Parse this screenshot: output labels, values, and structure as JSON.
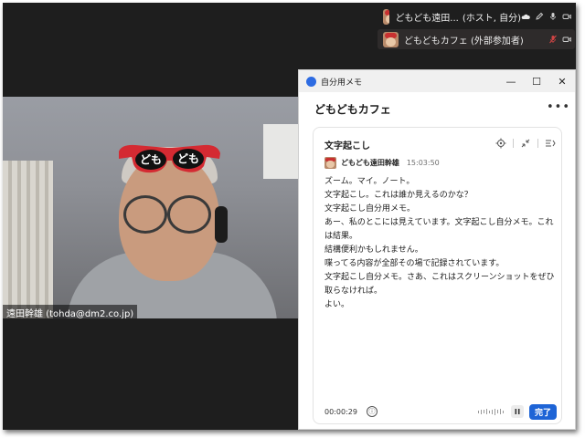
{
  "participants": [
    {
      "name": "どもども遠田...",
      "role": "(ホスト, 自分)"
    },
    {
      "name": "どもどもカフェ (外部参加者)",
      "role": ""
    }
  ],
  "video": {
    "caption": "遠田幹雄 (tohda@dm2.co.jp)",
    "glasses_text": [
      "ども",
      "ども"
    ]
  },
  "memo_window": {
    "title": "自分用メモ",
    "controls": [
      "—",
      "☐",
      "✕"
    ],
    "heading": "どもどもカフェ",
    "more_label": "•••"
  },
  "transcript_card": {
    "title": "文字起こし",
    "speaker_name": "どもども遠田幹雄",
    "speaker_time": "15:03:50",
    "lines": [
      "ズーム。マイ。ノート。",
      "文字起こし。これは誰か見えるのかな？",
      "文字起こし自分用メモ。",
      "あー、私のとこには見えています。文字起こし自分メモ。これ",
      "は結果。",
      "結構便利かもしれません。",
      "喋ってる内容が全部その場で記録されています。",
      "文字起こし自分メモ。さあ、これはスクリーンショットをぜひ",
      "取らなければ。",
      "よい。"
    ],
    "elapsed": "00:00:29",
    "info_icon": "ⓘ",
    "done_label": "完了"
  },
  "colors": {
    "accent": "#1e64d6",
    "meeting_bg": "#1e1e1e",
    "muted_red": "#d04444"
  }
}
